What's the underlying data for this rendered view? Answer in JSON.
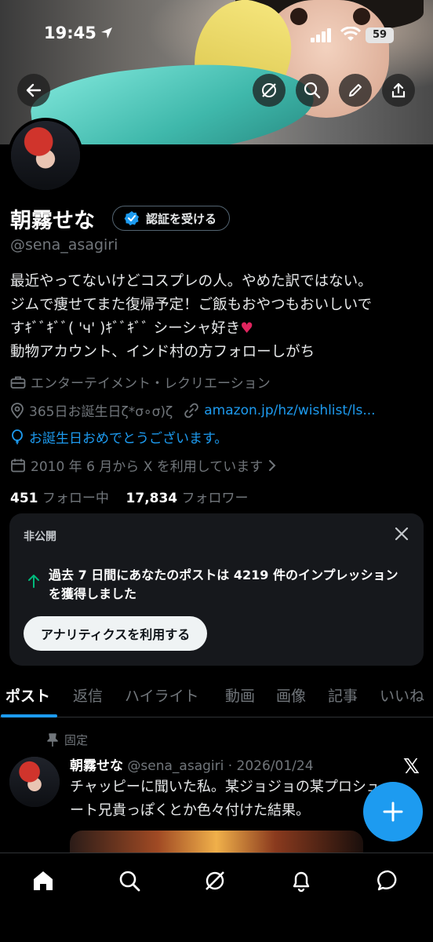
{
  "status_bar": {
    "time": "19:45",
    "battery": "59"
  },
  "profile": {
    "name": "朝霧せな",
    "verify_label": "認証を受ける",
    "handle": "@sena_asagiri",
    "bio_lines": [
      "最近やってないけどコスプレの人。やめた訳ではない。",
      "ジムで痩せてまた復帰予定！ご飯もおやつもおいしいで",
      "すｷﾞﾞｷﾞﾞ( 'ч' )ｷﾞﾞｷﾞﾞ シーシャ好き",
      "動物アカウント、インド村の方フォローしがち"
    ],
    "bio_heart": "♥",
    "category": "エンターテイメント・レクリエーション",
    "location": "365日お誕生日ζ*σ∘σ)ζ",
    "link": "amazon.jp/hz/wishlist/ls...",
    "birthday_text": "お誕生日おめでとうございます。",
    "joined": "2010 年 6 月から X を利用しています",
    "following_count": "451",
    "following_label": "フォロー中",
    "followers_count": "17,834",
    "followers_label": "フォロワー"
  },
  "private_card": {
    "title": "非公開",
    "message": "過去 7 日間にあなたのポストは 4219 件のインプレッションを獲得しました",
    "button": "アナリティクスを利用する"
  },
  "tabs": [
    "ポスト",
    "返信",
    "ハイライト",
    "動画",
    "画像",
    "記事",
    "いいね"
  ],
  "tweet": {
    "pinned_label": "固定",
    "author": "朝霧せな",
    "meta": "@sena_asagiri · 2026/01/24",
    "text": "チャッピーに聞いた私。某ジョジョの某プロシュート兄貴っぽくとか色々付けた結果。"
  },
  "colors": {
    "accent": "#1d9bf0",
    "background": "#000000",
    "card": "#16181c",
    "heart": "#e0245e"
  },
  "icons": [
    "location-arrow-icon",
    "signal-icon",
    "wifi-icon",
    "back-icon",
    "grok-icon",
    "search-icon",
    "edit-icon",
    "share-icon",
    "verified-badge-icon",
    "briefcase-icon",
    "location-icon",
    "link-icon",
    "balloon-icon",
    "calendar-icon",
    "chevron-right-icon",
    "close-icon",
    "arrow-up-icon",
    "pin-icon",
    "x-logo-icon",
    "plus-icon",
    "home-icon",
    "notifications-icon",
    "messages-icon"
  ]
}
